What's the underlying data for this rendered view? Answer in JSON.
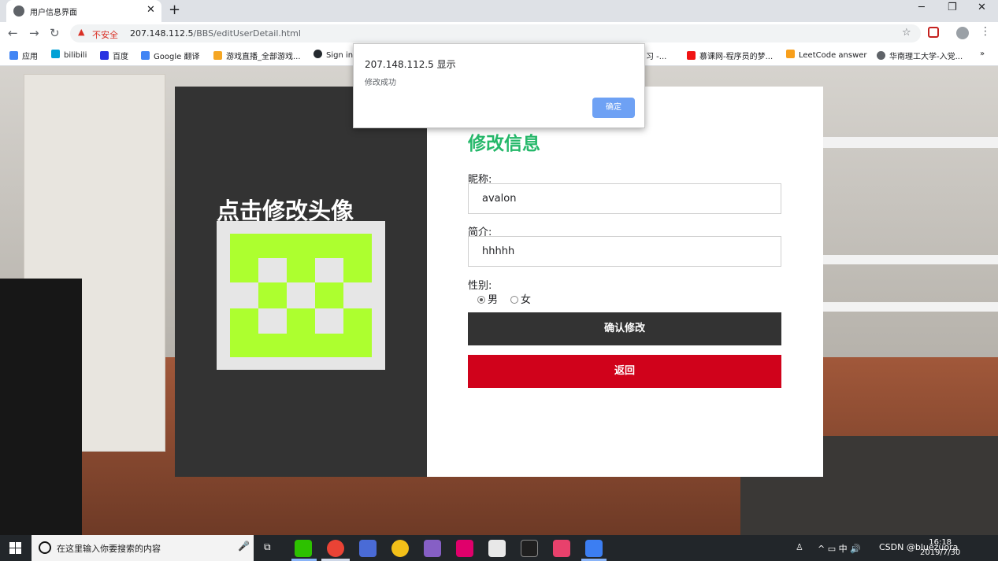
{
  "browser": {
    "tab_title": "用户信息界面",
    "tab_close": "✕",
    "new_tab": "+",
    "minimize": "─",
    "restore": "❐",
    "close": "✕",
    "back": "←",
    "forward": "→",
    "reload": "↻",
    "security_warning_icon": "▲",
    "security_label": "不安全",
    "url_host": "207.148.112.5",
    "url_path": "/BBS/editUserDetail.html",
    "bookmark_star": "☆",
    "menu_dots": "⋮"
  },
  "bookmarks": [
    {
      "label": "应用",
      "color": "#4285f4"
    },
    {
      "label": "bilibili",
      "color": "#00a1d6"
    },
    {
      "label": "百度",
      "color": "#2932e1"
    },
    {
      "label": "Google 翻译",
      "color": "#4285f4"
    },
    {
      "label": "游戏直播_全部游戏...",
      "color": "#f5a623"
    },
    {
      "label": "Sign in",
      "color": "#24292e"
    },
    {
      "label": "习 -...",
      "color": "#888888"
    },
    {
      "label": "慕课网-程序员的梦...",
      "color": "#f01414"
    },
    {
      "label": "LeetCode answer",
      "color": "#f89f1b"
    },
    {
      "label": "华南理工大学-入党...",
      "color": "#5f6368"
    }
  ],
  "bookmarks_more": "»",
  "page": {
    "avatar_title": "点击修改头像",
    "form_title": "修改信息",
    "nickname_label": "昵称:",
    "nickname_value": "avalon",
    "bio_label": "简介:",
    "bio_value": "hhhhh",
    "gender_label": "性别:",
    "gender_options": [
      "男",
      "女"
    ],
    "gender_selected": "男",
    "confirm_button": "确认修改",
    "back_button": "返回"
  },
  "alert": {
    "title": "207.148.112.5 显示",
    "message": "修改成功",
    "ok_button": "确定"
  },
  "taskbar": {
    "search_placeholder": "在这里输入你要搜索的内容",
    "mic_icon": "🎤",
    "task_view_icon": "⧉",
    "tray_text": "^ ▭ 中 🔊",
    "tray_extra": "CSDN @bluezuora",
    "time": "16:18",
    "date": "2019/7/30",
    "apps": [
      {
        "name": "wechat",
        "color": "#2dc100"
      },
      {
        "name": "chrome",
        "color": "#ea4335"
      },
      {
        "name": "app3",
        "color": "#4a6bd6"
      },
      {
        "name": "app4",
        "color": "#f3c019"
      },
      {
        "name": "visual-studio",
        "color": "#865fc5"
      },
      {
        "name": "app6",
        "color": "#e0006b"
      },
      {
        "name": "app7",
        "color": "#ffffff"
      },
      {
        "name": "qq",
        "color": "#1f1f1f"
      },
      {
        "name": "intellij",
        "color": "#e8416c"
      },
      {
        "name": "wps",
        "color": "#3c7ef2"
      }
    ]
  },
  "colors": {
    "form_title": "#25b86a",
    "avatar_pixels": "#adff2f",
    "back_button_bg": "#d0021b",
    "confirm_button_bg": "#333333",
    "alert_ok_bg": "#6ea1f4"
  }
}
